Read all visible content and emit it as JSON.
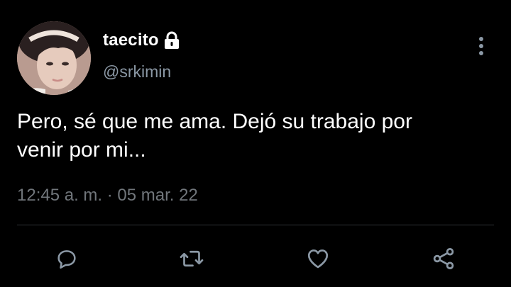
{
  "user": {
    "display_name": "taecito",
    "handle": "@srkimin",
    "protected_icon": "lock-icon",
    "avatar_icon": "profile-photo"
  },
  "tweet": {
    "text_line_1": "Pero, sé que me ama. Dejó su trabajo por",
    "text_line_2": "venir por mi...",
    "time": "12:45 a. m.",
    "separator": "·",
    "date": "05 mar. 22"
  },
  "actions": [
    {
      "name": "reply",
      "icon": "comment-icon"
    },
    {
      "name": "retweet",
      "icon": "retweet-icon"
    },
    {
      "name": "like",
      "icon": "heart-icon"
    },
    {
      "name": "share",
      "icon": "share-icon"
    }
  ],
  "colors": {
    "background": "#000000",
    "text": "#ffffff",
    "secondary": "#71767b",
    "divider": "#2f3336",
    "icon": "#8b98a5"
  }
}
